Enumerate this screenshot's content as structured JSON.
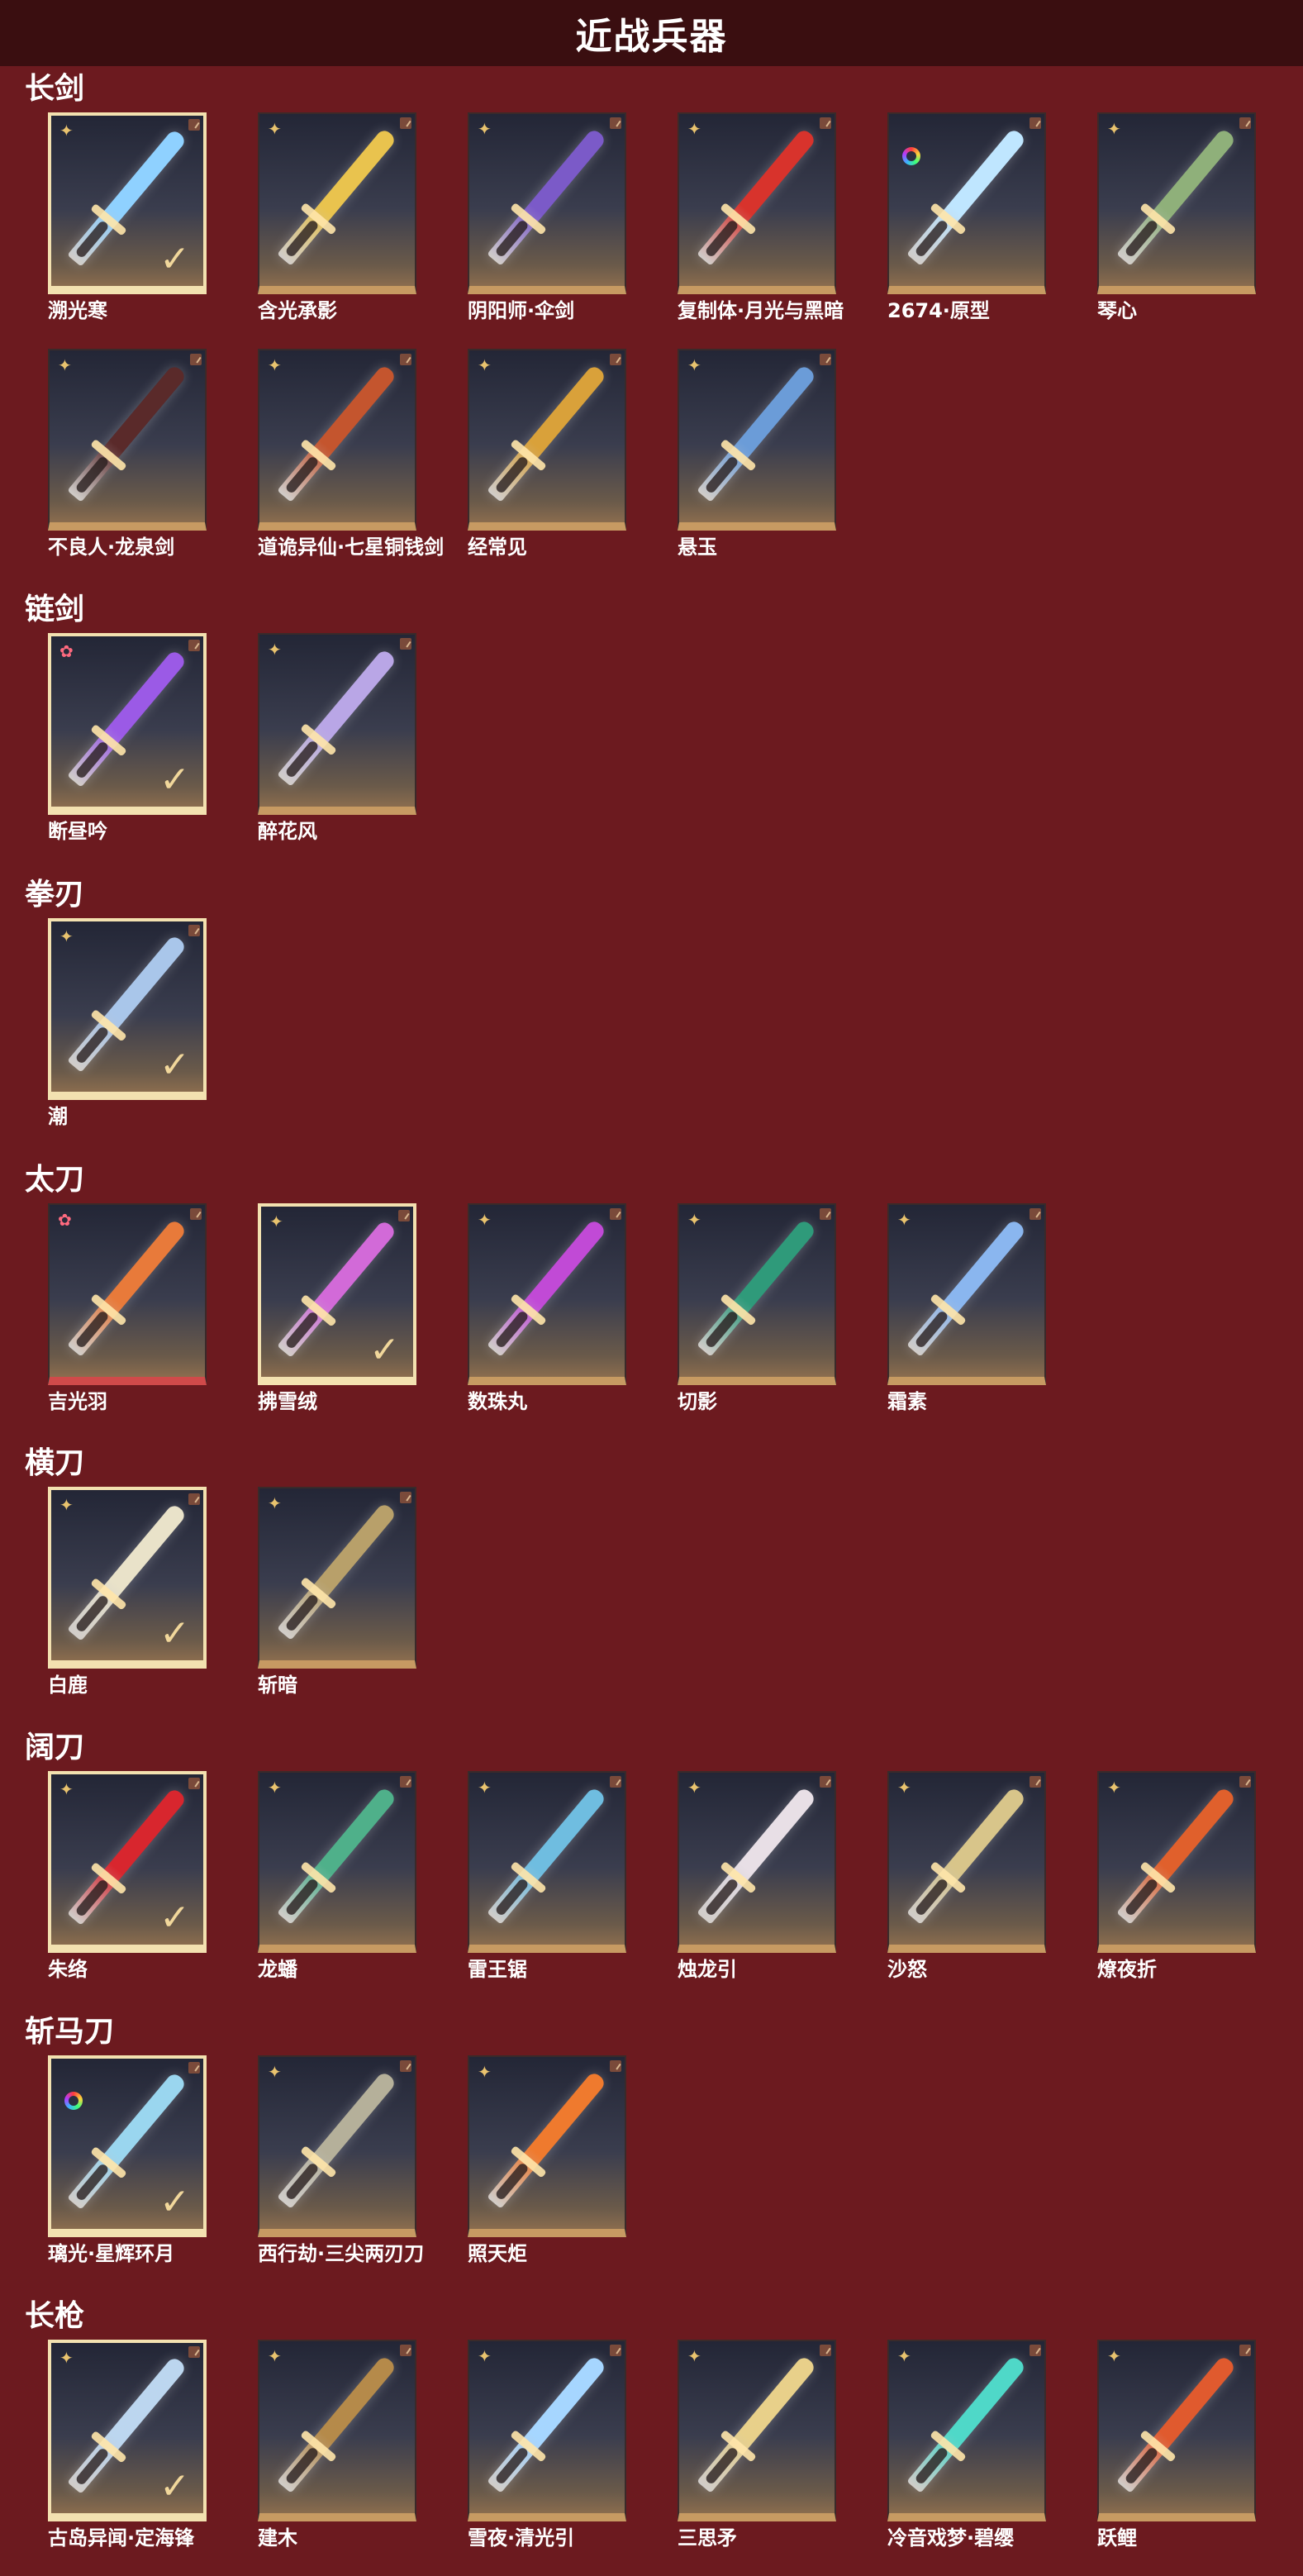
{
  "header": {
    "title": "近战兵器"
  },
  "sections": [
    {
      "title": "长剑",
      "items": [
        {
          "name": "溯光寒",
          "icon": "sword-blue-ice",
          "rarity": "gold",
          "selected": true,
          "color": "#8fd1ff"
        },
        {
          "name": "含光承影",
          "icon": "sword-gold",
          "rarity": "gold",
          "selected": false,
          "color": "#e9c34e"
        },
        {
          "name": "阴阳师·伞剑",
          "icon": "umbrella-sword",
          "rarity": "gold",
          "selected": false,
          "color": "#7b5ac8"
        },
        {
          "name": "复制体·月光与黑暗",
          "icon": "sword-red",
          "rarity": "gold",
          "selected": false,
          "color": "#d8332c"
        },
        {
          "name": "2674·原型",
          "icon": "lightsaber",
          "rarity": "ring",
          "selected": false,
          "color": "#bfe6ff"
        },
        {
          "name": "琴心",
          "icon": "sword-jade",
          "rarity": "gold",
          "selected": false,
          "color": "#8fb07a"
        },
        {
          "name": "不良人·龙泉剑",
          "icon": "sword-dark-red",
          "rarity": "gold",
          "selected": false,
          "color": "#5a2a2a"
        },
        {
          "name": "道诡异仙·七星铜钱剑",
          "icon": "coin-sword",
          "rarity": "gold",
          "selected": false,
          "color": "#c4552e"
        },
        {
          "name": "经常见",
          "icon": "sword-gold-ornate",
          "rarity": "gold",
          "selected": false,
          "color": "#d9a13a"
        },
        {
          "name": "悬玉",
          "icon": "sword-azure",
          "rarity": "gold",
          "selected": false,
          "color": "#6b9cd8"
        }
      ]
    },
    {
      "title": "链剑",
      "items": [
        {
          "name": "断昼吟",
          "icon": "chain-sword-purple",
          "rarity": "pink",
          "selected": true,
          "color": "#9b5ae6"
        },
        {
          "name": "醉花风",
          "icon": "chain-sword-lilac",
          "rarity": "gold",
          "selected": false,
          "color": "#b9a6e6"
        }
      ]
    },
    {
      "title": "拳刃",
      "items": [
        {
          "name": "潮",
          "icon": "claw-blade",
          "rarity": "gold",
          "selected": true,
          "color": "#a9c6ea"
        }
      ]
    },
    {
      "title": "太刀",
      "items": [
        {
          "name": "吉光羽",
          "icon": "katana-flame",
          "rarity": "pink",
          "selected": false,
          "color": "#e87a3a",
          "red": true
        },
        {
          "name": "拂雪绒",
          "icon": "katana-pink",
          "rarity": "gold",
          "selected": true,
          "color": "#d26ad8"
        },
        {
          "name": "数珠丸",
          "icon": "katana-magenta",
          "rarity": "gold",
          "selected": false,
          "color": "#c14ad6"
        },
        {
          "name": "切影",
          "icon": "katana-green",
          "rarity": "gold",
          "selected": false,
          "color": "#2f9a7a"
        },
        {
          "name": "霜素",
          "icon": "katana-frost",
          "rarity": "gold",
          "selected": false,
          "color": "#8ab6ef"
        }
      ]
    },
    {
      "title": "横刀",
      "items": [
        {
          "name": "白鹿",
          "icon": "saber-white",
          "rarity": "gold",
          "selected": true,
          "color": "#e9e2c9"
        },
        {
          "name": "斩暗",
          "icon": "saber-bronze",
          "rarity": "gold",
          "selected": false,
          "color": "#b8a06a"
        }
      ]
    },
    {
      "title": "阔刀",
      "items": [
        {
          "name": "朱络",
          "icon": "broadblade-red",
          "rarity": "gold",
          "selected": true,
          "color": "#d8262e"
        },
        {
          "name": "龙蟠",
          "icon": "broadblade-jade",
          "rarity": "gold",
          "selected": false,
          "color": "#4fb08a"
        },
        {
          "name": "雷王锯",
          "icon": "broadblade-cyan",
          "rarity": "gold",
          "selected": false,
          "color": "#6fbde0"
        },
        {
          "name": "烛龙引",
          "icon": "broadblade-white",
          "rarity": "gold",
          "selected": false,
          "color": "#e8dfe6"
        },
        {
          "name": "沙怒",
          "icon": "broadblade-gold",
          "rarity": "gold",
          "selected": false,
          "color": "#d8c58a"
        },
        {
          "name": "燎夜折",
          "icon": "broadblade-ember",
          "rarity": "gold",
          "selected": false,
          "color": "#e0602c"
        }
      ]
    },
    {
      "title": "斩马刀",
      "items": [
        {
          "name": "璃光·星辉环月",
          "icon": "glaive-moon",
          "rarity": "ring",
          "selected": true,
          "color": "#9ad6ef"
        },
        {
          "name": "西行劫·三尖两刃刀",
          "icon": "trident-blade",
          "rarity": "gold",
          "selected": false,
          "color": "#b5b09a"
        },
        {
          "name": "照天炬",
          "icon": "glaive-flame",
          "rarity": "gold",
          "selected": false,
          "color": "#ef7a2e"
        }
      ]
    },
    {
      "title": "长枪",
      "items": [
        {
          "name": "古岛异闻·定海锋",
          "icon": "spear-silver",
          "rarity": "gold",
          "selected": true,
          "color": "#bcd6ef"
        },
        {
          "name": "建木",
          "icon": "spear-wood",
          "rarity": "gold",
          "selected": false,
          "color": "#b58a4a"
        },
        {
          "name": "雪夜·清光引",
          "icon": "spear-ice",
          "rarity": "gold",
          "selected": false,
          "color": "#a6d6ff"
        },
        {
          "name": "三思矛",
          "icon": "spear-gold",
          "rarity": "gold",
          "selected": false,
          "color": "#e8d08a"
        },
        {
          "name": "冷音戏梦·碧缨",
          "icon": "spear-teal",
          "rarity": "gold",
          "selected": false,
          "color": "#4fd8c8"
        },
        {
          "name": "跃鲤",
          "icon": "spear-koi",
          "rarity": "gold",
          "selected": false,
          "color": "#e05a2e"
        }
      ]
    }
  ]
}
